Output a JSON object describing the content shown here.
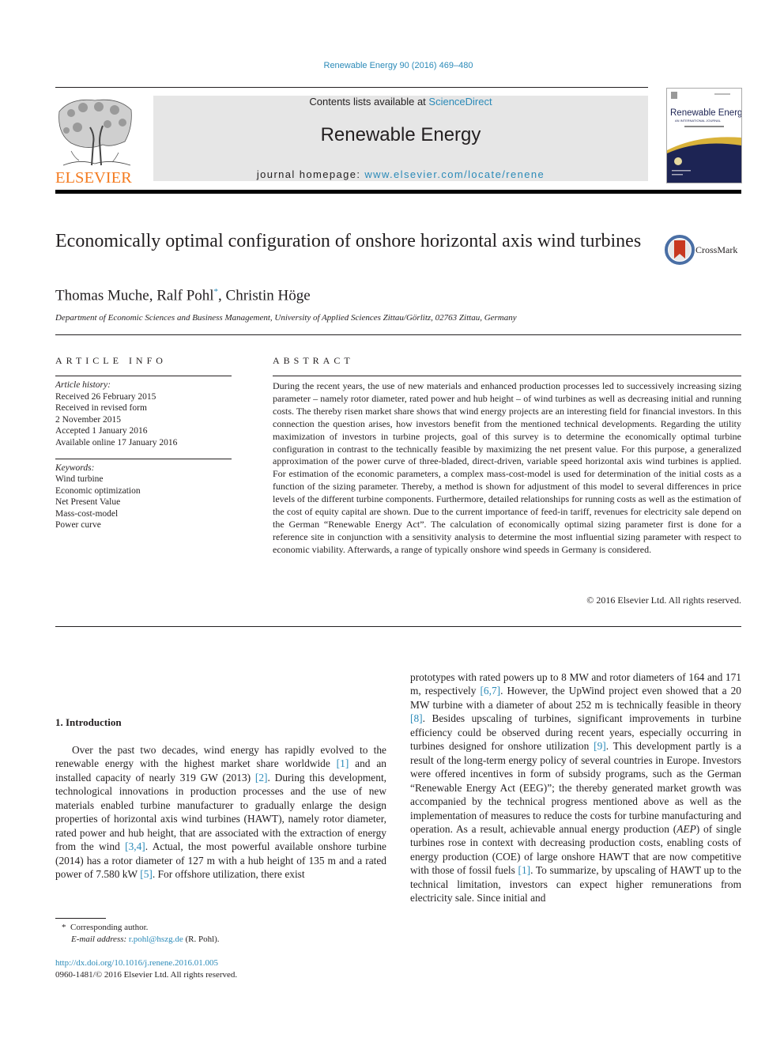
{
  "header": {
    "citation": "Renewable Energy 90 (2016) 469–480",
    "contents_prefix": "Contents lists available at ",
    "contents_link": "ScienceDirect",
    "journal_name": "Renewable Energy",
    "homepage_prefix": "journal homepage: ",
    "homepage_link": "www.elsevier.com/locate/renene",
    "publisher_logo_text": "ELSEVIER",
    "cover_title": "Renewable Energy",
    "cover_subtitle": "AN INTERNATIONAL JOURNAL",
    "colors": {
      "link": "#2b8ab8",
      "elsevier_orange": "#f47b20",
      "cover_navy": "#1d2454",
      "cover_gold": "#d9b23a",
      "banner_gray": "#e6e6e6"
    }
  },
  "article": {
    "title": "Economically optimal configuration of onshore horizontal axis wind turbines",
    "crossmark_label": "CrossMark",
    "authors": [
      {
        "name": "Thomas Muche",
        "mark": ""
      },
      {
        "name": "Ralf Pohl",
        "mark": "*"
      },
      {
        "name": "Christin Höge",
        "mark": ""
      }
    ],
    "affiliation": "Department of Economic Sciences and Business Management, University of Applied Sciences Zittau/Görlitz, 02763 Zittau, Germany"
  },
  "article_info": {
    "heading": "ARTICLE INFO",
    "history_label": "Article history:",
    "history": [
      "Received 26 February 2015",
      "Received in revised form",
      "2 November 2015",
      "Accepted 1 January 2016",
      "Available online 17 January 2016"
    ],
    "keywords_label": "Keywords:",
    "keywords": [
      "Wind turbine",
      "Economic optimization",
      "Net Present Value",
      "Mass-cost-model",
      "Power curve"
    ]
  },
  "abstract": {
    "heading": "ABSTRACT",
    "text": "During the recent years, the use of new materials and enhanced production processes led to successively increasing sizing parameter – namely rotor diameter, rated power and hub height – of wind turbines as well as decreasing initial and running costs. The thereby risen market share shows that wind energy projects are an interesting field for financial investors. In this connection the question arises, how investors benefit from the mentioned technical developments. Regarding the utility maximization of investors in turbine projects, goal of this survey is to determine the economically optimal turbine configuration in contrast to the technically feasible by maximizing the net present value. For this purpose, a generalized approximation of the power curve of three-bladed, direct-driven, variable speed horizontal axis wind turbines is applied. For estimation of the economic parameters, a complex mass-cost-model is used for determination of the initial costs as a function of the sizing parameter. Thereby, a method is shown for adjustment of this model to several differences in price levels of the different turbine components. Furthermore, detailed relationships for running costs as well as the estimation of the cost of equity capital are shown. Due to the current importance of feed-in tariff, revenues for electricity sale depend on the German “Renewable Energy Act”. The calculation of economically optimal sizing parameter first is done for a reference site in conjunction with a sensitivity analysis to determine the most influential sizing parameter with respect to economic viability. Afterwards, a range of typically onshore wind speeds in Germany is considered.",
    "copyright": "© 2016 Elsevier Ltd. All rights reserved."
  },
  "body": {
    "section_heading": "1.  Introduction",
    "left_segments": [
      {
        "t": "Over the past two decades, wind energy has rapidly evolved to the renewable energy with the highest market share worldwide "
      },
      {
        "ref": "[1]"
      },
      {
        "t": " and an installed capacity of nearly 319 GW (2013) "
      },
      {
        "ref": "[2]"
      },
      {
        "t": ". During this development, technological innovations in production processes and the use of new materials enabled turbine manufacturer to gradually enlarge the design properties of horizontal axis wind turbines (HAWT), namely rotor diameter, rated power and hub height, that are associated with the extraction of energy from the wind "
      },
      {
        "ref": "[3,4]"
      },
      {
        "t": ". Actual, the most powerful available onshore turbine (2014) has a rotor diameter of 127 m with a hub height of 135 m and a rated power of 7.580 kW "
      },
      {
        "ref": "[5]"
      },
      {
        "t": ". For offshore utilization, there exist"
      }
    ],
    "right_segments": [
      {
        "t": "prototypes with rated powers up to 8 MW and rotor diameters of 164 and 171 m, respectively "
      },
      {
        "ref": "[6,7]"
      },
      {
        "t": ". However, the UpWind project even showed that a 20 MW turbine with a diameter of about 252 m is technically feasible in theory "
      },
      {
        "ref": "[8]"
      },
      {
        "t": ". Besides upscaling of turbines, significant improvements in turbine efficiency could be observed during recent years, especially occurring in turbines designed for onshore utilization "
      },
      {
        "ref": "[9]"
      },
      {
        "t": ". This development partly is a result of the long-term energy policy of several countries in Europe. Investors were offered incentives in form of subsidy programs, such as the German “Renewable Energy Act (EEG)”; the thereby generated market growth was accompanied by the technical progress mentioned above as well as the implementation of measures to reduce the costs for turbine manufacturing and operation. As a result, achievable annual energy production ("
      },
      {
        "i": "AEP"
      },
      {
        "t": ") of single turbines rose in context with decreasing production costs, enabling costs of energy production (COE) of large onshore HAWT that are now competitive with those of fossil fuels "
      },
      {
        "ref": "[1]"
      },
      {
        "t": ". To summarize, by upscaling of HAWT up to the technical limitation, investors can expect higher remunerations from electricity sale. Since initial and"
      }
    ]
  },
  "footnotes": {
    "marker": "*",
    "corresponding": "Corresponding author.",
    "email_label": "E-mail address:",
    "email": "r.pohl@hszg.de",
    "email_suffix": " (R. Pohl).",
    "doi": "http://dx.doi.org/10.1016/j.renene.2016.01.005",
    "issn_line": "0960-1481/© 2016 Elsevier Ltd. All rights reserved."
  }
}
